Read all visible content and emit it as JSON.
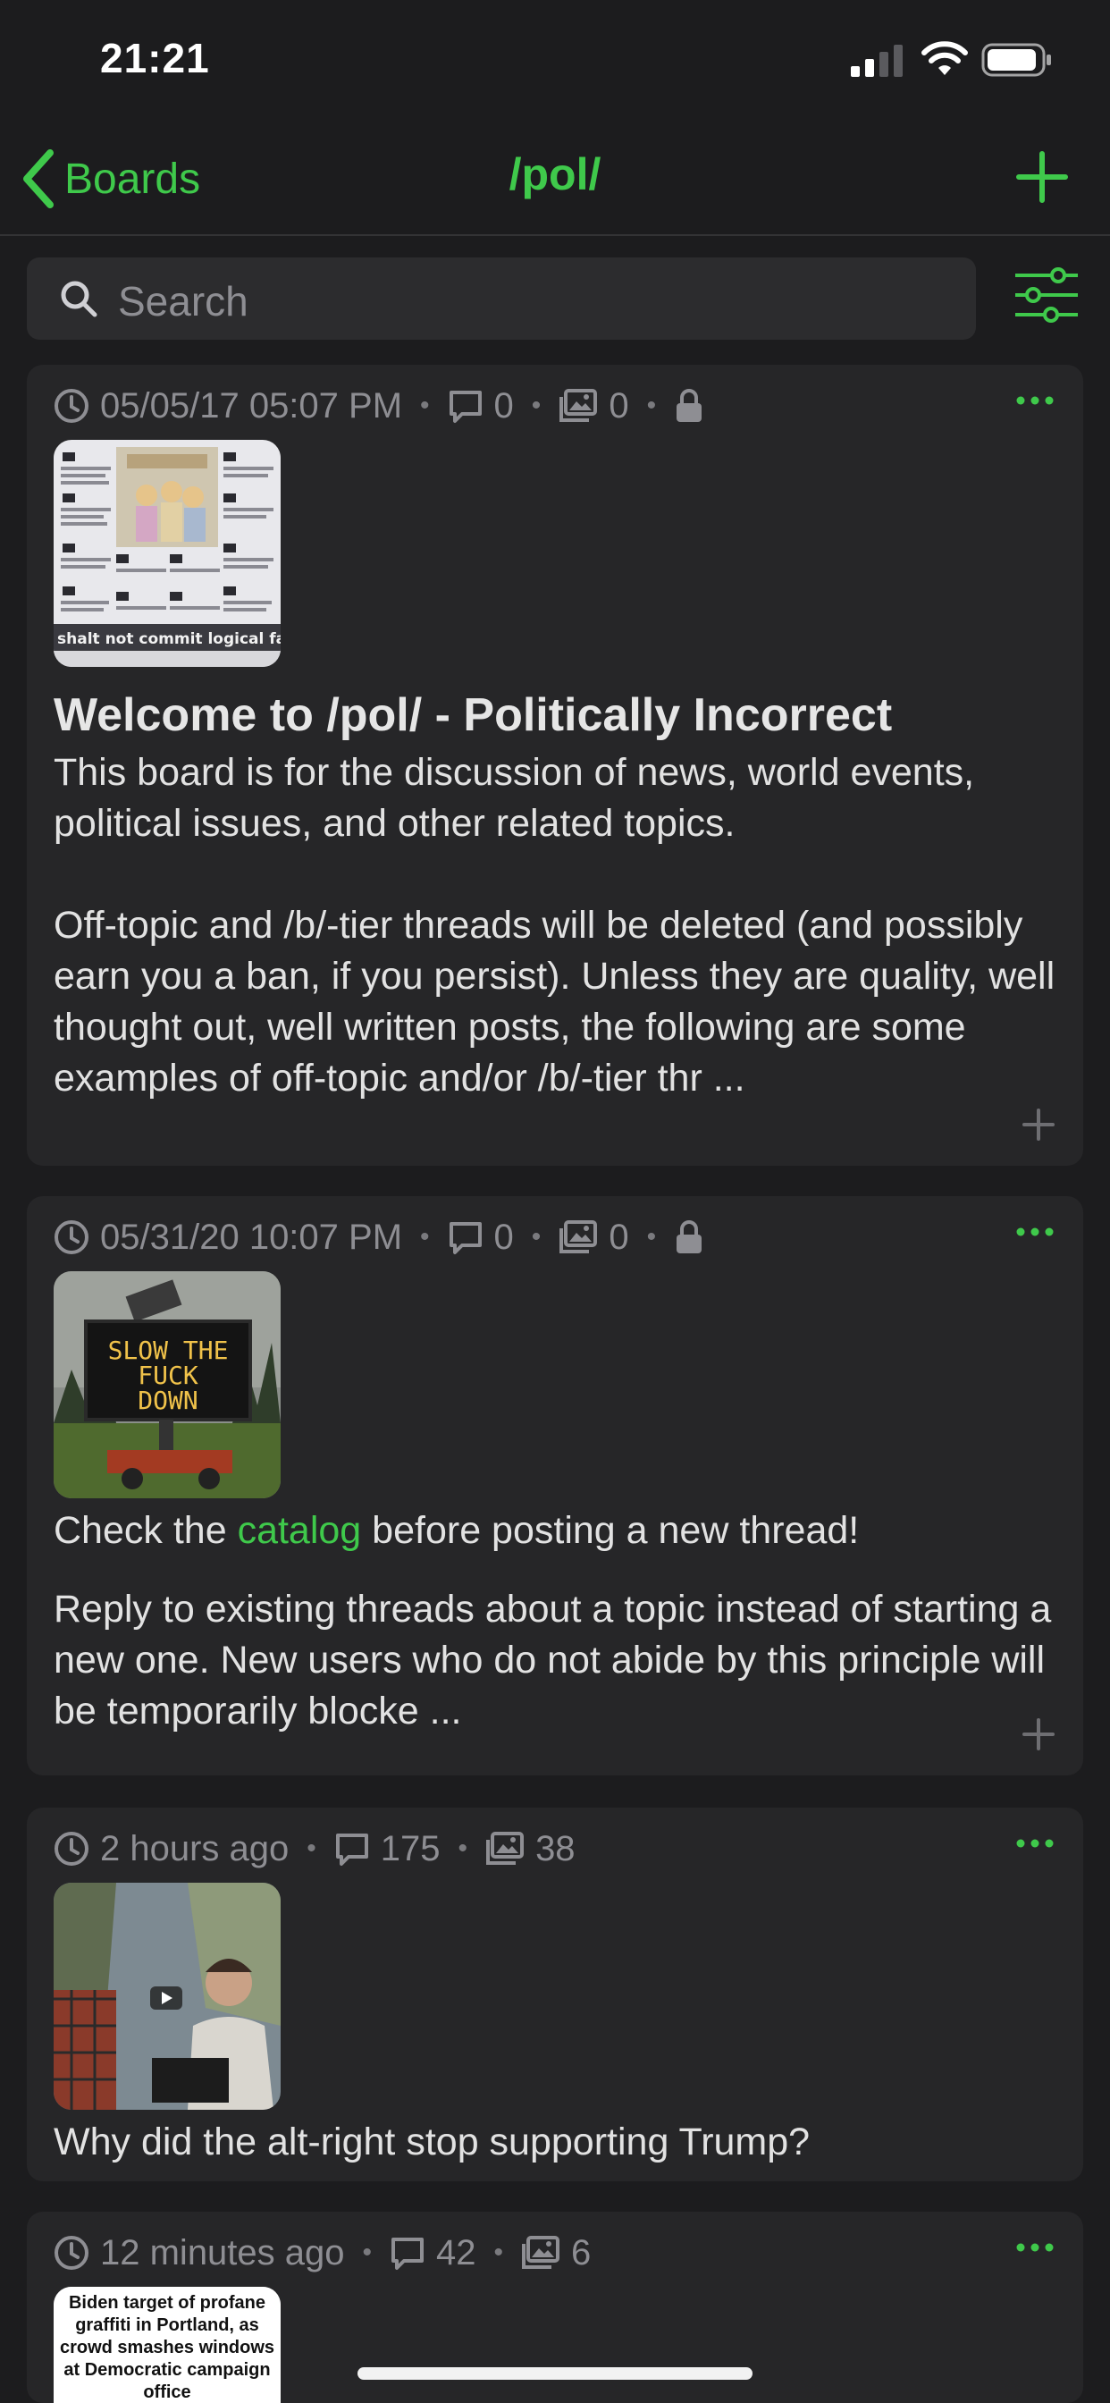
{
  "status_bar": {
    "time": "21:21"
  },
  "nav": {
    "back_label": "Boards",
    "title": "/pol/",
    "add_icon": "plus-icon"
  },
  "search": {
    "placeholder": "Search",
    "filter_icon": "sliders-icon"
  },
  "colors": {
    "accent": "#3fc94b",
    "background": "#1c1c1e",
    "card": "#262628",
    "meta": "#8e8e93"
  },
  "threads": [
    {
      "date": "05/05/17 05:07 PM",
      "replies": "0",
      "images": "0",
      "locked": true,
      "thumb_caption": "shalt not commit logical falla",
      "title": "Welcome to /pol/ - Politically Incorrect",
      "text": "This board is for the discussion of news, world events, political issues, and other related topics.\n\nOff-topic and /b/-tier threads will be deleted (and possibly earn you a ban, if you persist). Unless they are quality, well thought out, well written posts, the following are some examples of off-topic and/or /b/-tier thr ..."
    },
    {
      "date": "05/31/20 10:07 PM",
      "replies": "0",
      "images": "0",
      "locked": true,
      "thumb_sign": [
        "SLOW THE",
        "FUCK",
        "DOWN"
      ],
      "text_before_link": "Check the ",
      "link": "catalog",
      "text_after_link": " before posting a new thread!",
      "text2": "Reply to existing threads about a topic instead of starting a new one. New users who do not abide by this principle will be temporarily blocke ..."
    },
    {
      "date": "2 hours ago",
      "replies": "175",
      "images": "38",
      "locked": false,
      "text": "Why did the alt-right stop supporting Trump?"
    },
    {
      "date": "12 minutes ago",
      "replies": "42",
      "images": "6",
      "locked": false,
      "thumb_headline": [
        "Biden target of profane",
        "graffiti in Portland, as",
        "crowd smashes windows",
        "at Democratic campaign",
        "office"
      ]
    }
  ]
}
